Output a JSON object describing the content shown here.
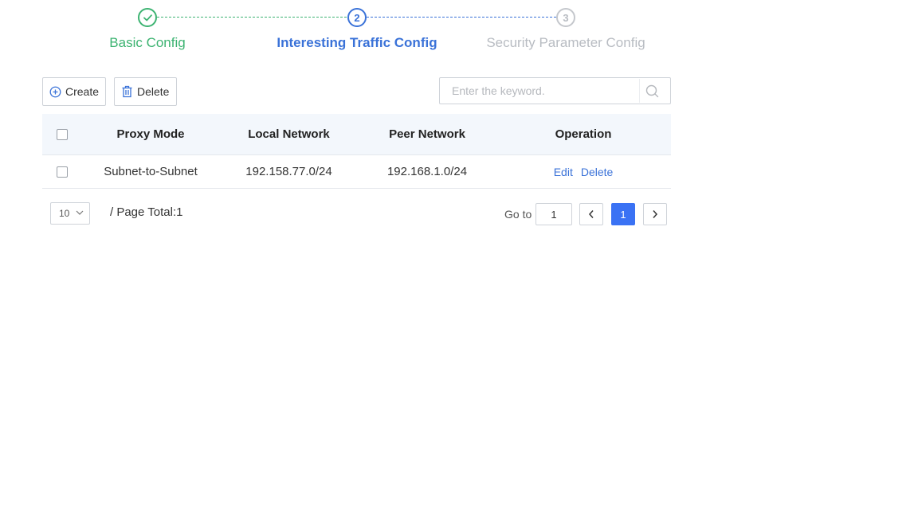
{
  "stepper": {
    "steps": [
      {
        "number": "",
        "label": "Basic Config",
        "state": "done"
      },
      {
        "number": "2",
        "label": "Interesting Traffic Config",
        "state": "active"
      },
      {
        "number": "3",
        "label": "Security Parameter Config",
        "state": "todo"
      }
    ]
  },
  "toolbar": {
    "create_label": "Create",
    "delete_label": "Delete"
  },
  "search": {
    "placeholder": "Enter the keyword."
  },
  "table": {
    "columns": [
      "Proxy Mode",
      "Local Network",
      "Peer Network",
      "Operation"
    ],
    "rows": [
      {
        "proxy_mode": "Subnet-to-Subnet",
        "local_network": "192.158.77.0/24",
        "peer_network": "192.168.1.0/24",
        "edit_label": "Edit",
        "delete_label": "Delete"
      }
    ]
  },
  "pagination": {
    "page_size": "10",
    "total_text": "/ Page Total:1",
    "goto_label": "Go to",
    "goto_value": "1",
    "current_page": "1"
  },
  "colors": {
    "done": "#3cb371",
    "active": "#3a72d8",
    "todo": "#b8bcc2",
    "header_bg": "#f3f7fc",
    "page_active": "#3a72f4"
  }
}
